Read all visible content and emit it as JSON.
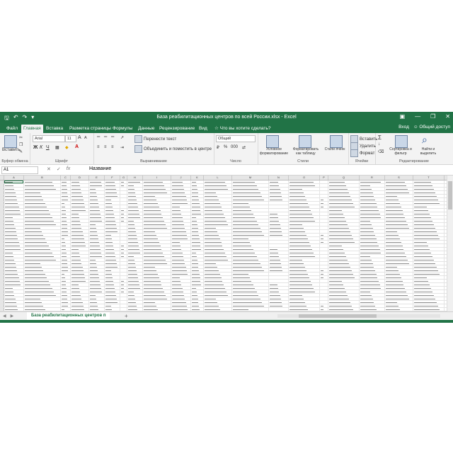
{
  "window": {
    "title": "База реабилитационных центров по всей России.xlsx - Excel",
    "quick_access": [
      "save-icon",
      "undo-icon",
      "redo-icon",
      "customize-icon"
    ],
    "controls": [
      "ribbon-display-icon",
      "minimize-icon",
      "restore-icon",
      "close-icon"
    ]
  },
  "tabs": {
    "items": [
      "Файл",
      "Главная",
      "Вставка",
      "Разметка страницы",
      "Формулы",
      "Данные",
      "Рецензирование",
      "Вид",
      "Что вы хотите сделать?"
    ],
    "active": "Главная",
    "signin": "Вход",
    "share": "Общий доступ"
  },
  "ribbon": {
    "clipboard": {
      "label": "Буфер обмена",
      "paste": "Вставить"
    },
    "font": {
      "label": "Шрифт",
      "name": "Arial",
      "size": "11",
      "bold": "Ж",
      "italic": "К",
      "underline": "Ч",
      "grow": "A",
      "shrink": "A"
    },
    "alignment": {
      "label": "Выравнивание",
      "wrap": "Перенести текст",
      "merge": "Объединить и поместить в центре"
    },
    "number": {
      "label": "Число",
      "format": "Общий",
      "percent": "%",
      "thousands": "000"
    },
    "styles": {
      "label": "Стили",
      "conditional": "Условное форматирование",
      "as_table": "Форматировать как таблицу",
      "cell_styles": "Стили ячеек"
    },
    "cells": {
      "label": "Ячейки",
      "insert": "Вставить",
      "delete": "Удалить",
      "format": "Формат"
    },
    "editing": {
      "label": "Редактирование",
      "autosum": "Σ",
      "sort": "Сортировка и фильтр",
      "find": "Найти и выделить"
    }
  },
  "formula_bar": {
    "name_box": "A1",
    "value": "Название",
    "icons": [
      "cancel-icon",
      "enter-icon",
      "function-icon"
    ]
  },
  "sheet": {
    "columns": [
      "A",
      "B",
      "C",
      "D",
      "E",
      "F",
      "G",
      "H",
      "I",
      "J",
      "K",
      "L",
      "M",
      "N",
      "O",
      "P",
      "Q",
      "R",
      "S",
      "T"
    ],
    "tab": "База реабилитационных центров п",
    "add": "+"
  }
}
